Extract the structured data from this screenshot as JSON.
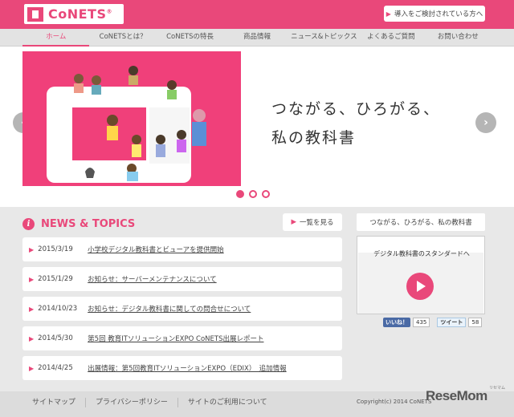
{
  "header": {
    "logo_text": "CoNETS",
    "logo_reg": "®",
    "intro_label": "導入をご検討されている方へ"
  },
  "nav": {
    "items": [
      "ホーム",
      "CoNETSとは？",
      "CoNETSの特長",
      "商品情報",
      "ニュース&トピックス",
      "よくあるご質問",
      "お問い合わせ"
    ],
    "active_index": 0
  },
  "hero": {
    "tagline_line1": "つながる、ひろがる、",
    "tagline_line2": "私の教科書",
    "prev_icon": "chevron-left-icon",
    "next_icon": "chevron-right-icon",
    "slide_count": 3,
    "active_slide": 0
  },
  "news": {
    "title": "NEWS & TOPICS",
    "list_label": "一覧を見る",
    "items": [
      {
        "date": "2015/3/19",
        "text": "小学校デジタル教科書とビューアを提供開始"
      },
      {
        "date": "2015/1/29",
        "text": "お知らせ：サーバーメンテナンスについて"
      },
      {
        "date": "2014/10/23",
        "text": "お知らせ：デジタル教科書に関しての問合せについて"
      },
      {
        "date": "2014/5/30",
        "text": "第5回 教育ITソリューションEXPO CoNETS出展レポート"
      },
      {
        "date": "2014/4/25",
        "text": "出展情報：第5回教育ITソリューションEXPO（EDIX）　追加情報"
      }
    ]
  },
  "sidebar": {
    "title": "つながる、ひろがる、私の教科書",
    "video_caption": "デジタル教科書のスタンダードへ",
    "fb_label": "いいね！",
    "fb_count": "435",
    "tw_label": "ツイート",
    "tw_count": "58"
  },
  "footer": {
    "links": [
      "サイトマップ",
      "プライバシーポリシー",
      "サイトのご利用について"
    ],
    "copyright": "Copyright(c) 2014 CoNETS"
  },
  "watermark": {
    "text": "ReseMom",
    "sub": "リセマム"
  },
  "colors": {
    "accent": "#e9487a",
    "nav_bg": "#e3e3e3",
    "content_bg": "#e8e8e8"
  }
}
